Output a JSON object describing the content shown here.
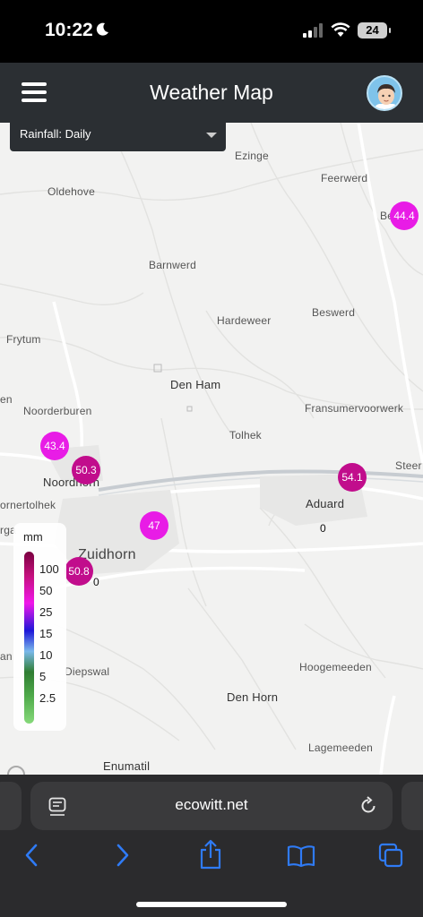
{
  "status_bar": {
    "time": "10:22",
    "battery": "24"
  },
  "header": {
    "title": "Weather Map"
  },
  "layer_select": {
    "value": "Rainfall: Daily"
  },
  "places": {
    "ezinge": "Ezinge",
    "feerwerd": "Feerwerd",
    "oldehove": "Oldehove",
    "barnwerd": "Barnwerd",
    "beswerd": "Beswerd",
    "hardeweer": "Hardeweer",
    "frytum": "Frytum",
    "den_ham": "Den Ham",
    "fransumervoorwerk": "Fransumervoorwerk",
    "noorderburen": "Noorderburen",
    "tolhek": "Tolhek",
    "noordhorn": "Noordhorn",
    "steer": "Steer",
    "aduard": "Aduard",
    "ornertolhek": "ornertolhek",
    "zuidhorn": "Zuidhorn",
    "diepswal": "Diepswal",
    "hoogemeeden": "Hoogemeeden",
    "den_horn": "Den Horn",
    "lagemeeden": "Lagemeeden",
    "enumatil": "Enumatil",
    "en_left": "en",
    "an_left": "an",
    "rga_left": "rga",
    "be_right": "Be"
  },
  "markers": [
    {
      "value": "44.4",
      "tone": "magenta"
    },
    {
      "value": "43.4",
      "tone": "magenta"
    },
    {
      "value": "50.3",
      "tone": "dark"
    },
    {
      "value": "54.1",
      "tone": "dark"
    },
    {
      "value": "47",
      "tone": "magenta"
    },
    {
      "value": "50.8",
      "tone": "dark"
    }
  ],
  "zero_labels": [
    "0",
    "0"
  ],
  "legend": {
    "unit": "mm",
    "labels": [
      "100",
      "50",
      "25",
      "15",
      "10",
      "5",
      "2.5"
    ]
  },
  "browser": {
    "url": "ecowitt.net"
  },
  "colors": {
    "header_bg": "#2b2f33",
    "marker_magenta": "#e81ce6",
    "marker_dark": "#c10d8c",
    "ios_blue": "#2f7bf6"
  },
  "icons": [
    "moon-icon",
    "signal-icon",
    "wifi-icon",
    "battery-icon",
    "menu-icon",
    "avatar",
    "reader-icon",
    "reload-icon",
    "back-icon",
    "forward-icon",
    "share-icon",
    "bookmarks-icon",
    "tabs-icon"
  ]
}
